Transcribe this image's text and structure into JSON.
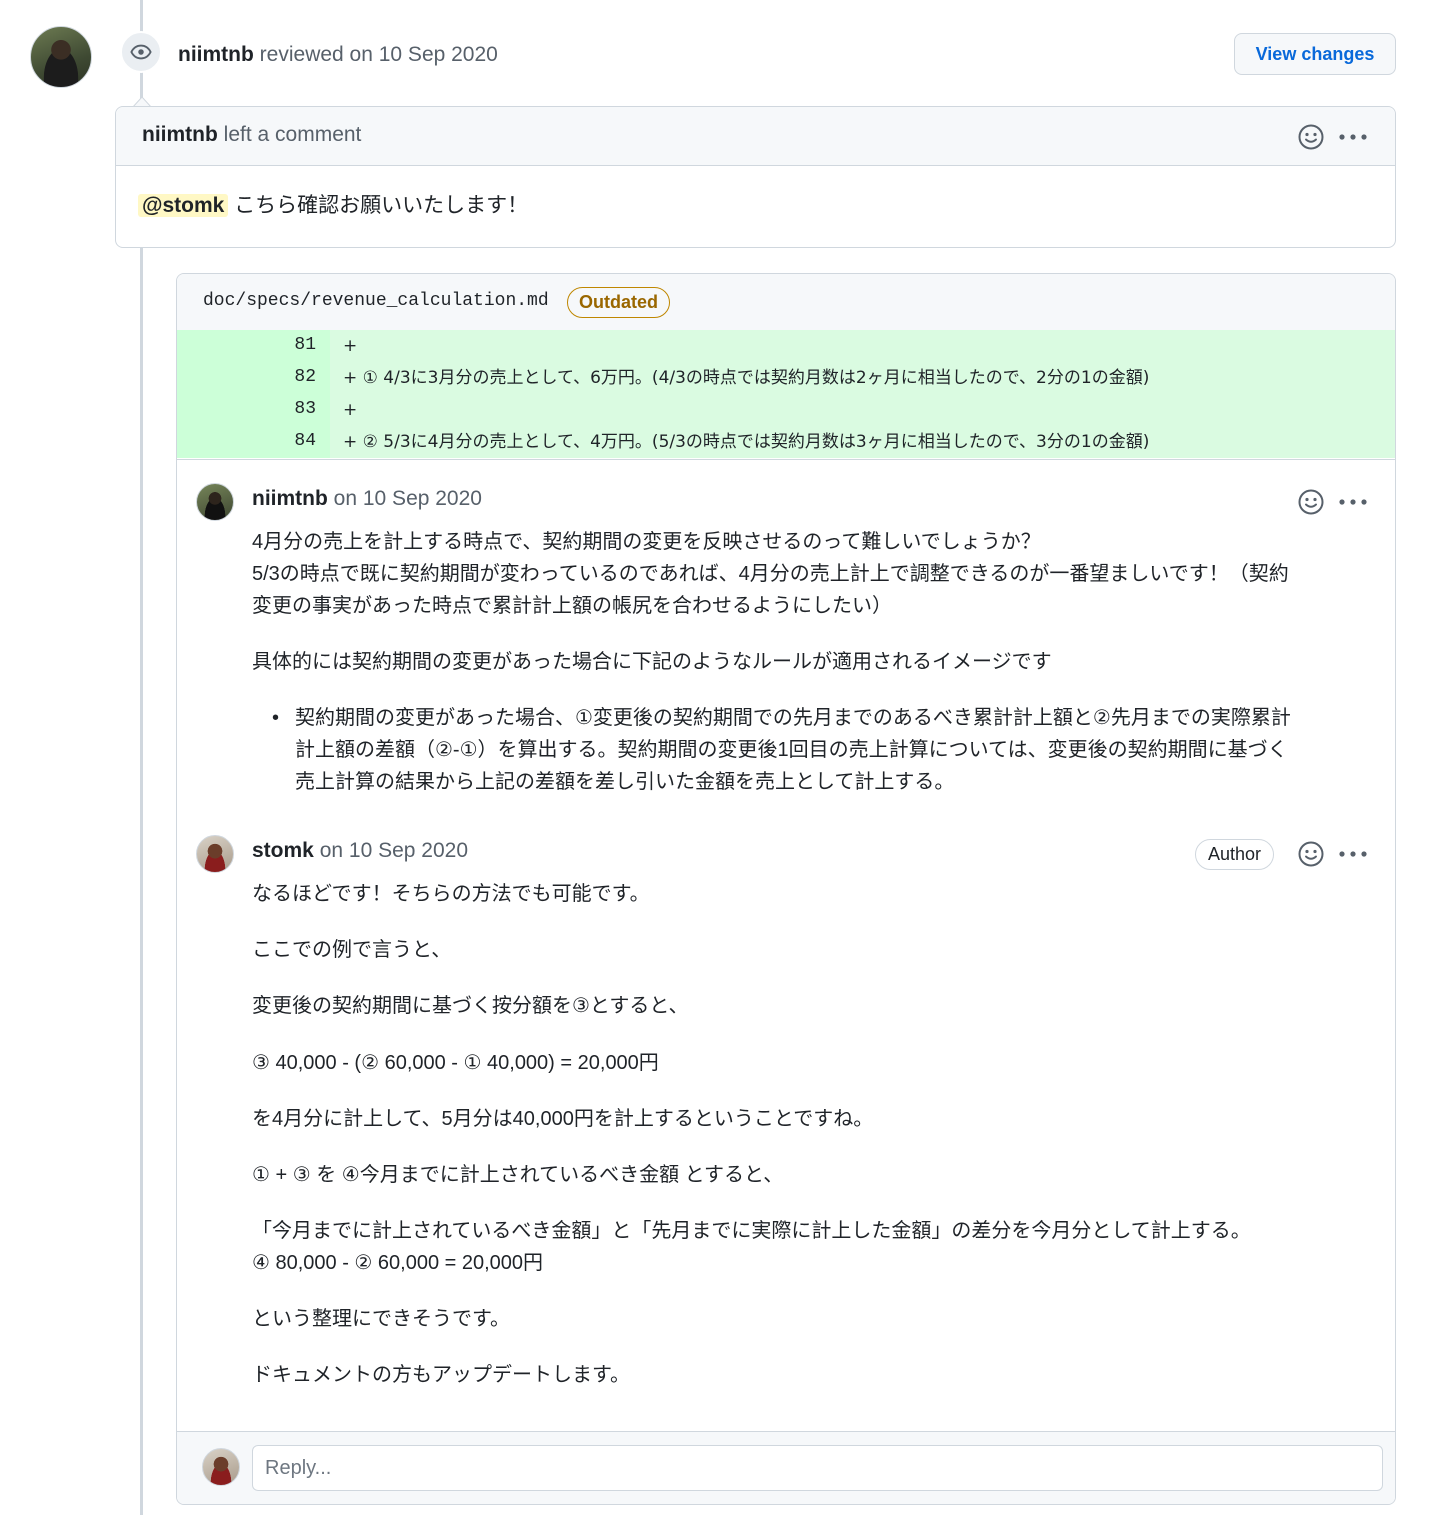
{
  "review": {
    "author": "niimtnb",
    "action": "reviewed on 10 Sep 2020",
    "view_changes_label": "View changes"
  },
  "review_comment": {
    "author": "niimtnb",
    "action": "left a comment",
    "mention": "@stomk",
    "text": "こちら確認お願いいたします！"
  },
  "file": {
    "path": "doc/specs/revenue_calculation.md",
    "badge": "Outdated"
  },
  "diff_lines": [
    {
      "num": "81",
      "marker": "+",
      "text": ""
    },
    {
      "num": "82",
      "marker": "+",
      "text": "① 4/3に3月分の売上として、6万円。(4/3の時点では契約月数は2ヶ月に相当したので、2分の1の金額)"
    },
    {
      "num": "83",
      "marker": "+",
      "text": ""
    },
    {
      "num": "84",
      "marker": "+",
      "text": "② 5/3に4月分の売上として、4万円。(5/3の時点では契約月数は3ヶ月に相当したので、3分の1の金額)"
    }
  ],
  "comments": [
    {
      "author": "niimtnb",
      "date": "on 10 Sep 2020",
      "lines": [
        "4月分の売上を計上する時点で、契約期間の変更を反映させるのって難しいでしょうか？",
        "5/3の時点で既に契約期間が変わっているのであれば、4月分の売上計上で調整できるのが一番望ましいです！（契約",
        "変更の事実があった時点で累計計上額の帳尻を合わせるようにしたい）",
        "具体的には契約期間の変更があった場合に下記のようなルールが適用されるイメージです"
      ],
      "bullet_lines": [
        "契約期間の変更があった場合、①変更後の契約期間での先月までのあるべき累計計上額と②先月までの実際累計",
        "計上額の差額（②-①）を算出する。契約期間の変更後1回目の売上計算については、変更後の契約期間に基づく",
        "売上計算の結果から上記の差額を差し引いた金額を売上として計上する。"
      ]
    },
    {
      "author": "stomk",
      "date": "on 10 Sep 2020",
      "badge": "Author",
      "lines": [
        "なるほどです！そちらの方法でも可能です。",
        "ここでの例で言うと、",
        "変更後の契約期間に基づく按分額を③とすると、",
        "③ 40,000 - (② 60,000 - ① 40,000) = 20,000円",
        "を4月分に計上して、5月分は40,000円を計上するということですね。",
        "① + ③ を ④今月までに計上されているべき金額 とすると、",
        "「今月までに計上されているべき金額」と「先月までに実際に計上した金額」の差分を今月分として計上する。",
        "④ 80,000 - ② 60,000 = 20,000円",
        "という整理にできそうです。",
        "ドキュメントの方もアップデートします。"
      ]
    }
  ],
  "reply": {
    "placeholder": "Reply..."
  },
  "icons": [
    "eye-icon",
    "smiley-icon",
    "kebab-menu-icon"
  ],
  "colors": {
    "link": "#0969da",
    "outdated": "#9a6700",
    "diff_add": "#dafbe1",
    "mention_bg": "#fff8c5"
  }
}
